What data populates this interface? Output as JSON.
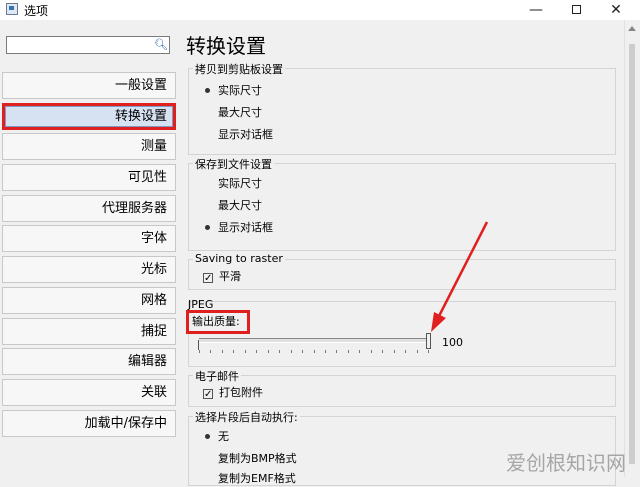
{
  "window": {
    "title": "选项",
    "minimize_label": "—",
    "close_label": "✕"
  },
  "search": {
    "value": "",
    "placeholder": ""
  },
  "nav": {
    "items": [
      "一般设置",
      "转换设置",
      "测量",
      "可见性",
      "代理服务器",
      "字体",
      "光标",
      "网格",
      "捕捉",
      "编辑器",
      "关联",
      "加载中/保存中"
    ],
    "active_index": 1
  },
  "page": {
    "title": "转换设置",
    "clipboard": {
      "legend": "拷贝到剪贴板设置",
      "options": [
        "实际尺寸",
        "最大尺寸",
        "显示对话框"
      ],
      "selected": 0
    },
    "file": {
      "legend": "保存到文件设置",
      "options": [
        "实际尺寸",
        "最大尺寸",
        "显示对话框"
      ],
      "selected": 2
    },
    "raster": {
      "legend": "Saving to raster",
      "smooth_label": "平滑",
      "smooth_checked": true
    },
    "jpeg": {
      "legend": "JPEG",
      "quality_label": "输出质量:",
      "quality_value": "100",
      "quality_fraction": 1.0
    },
    "email": {
      "legend": "电子邮件",
      "pack_label": "打包附件",
      "pack_checked": true
    },
    "autorun": {
      "legend": "选择片段后自动执行:",
      "options": [
        "无",
        "复制为BMP格式",
        "复制为EMF格式"
      ],
      "selected": 0
    }
  },
  "watermark": "爱创根知识网",
  "colors": {
    "highlight_red": "#e0201e",
    "active_nav_bg": "#d6e1f2"
  }
}
